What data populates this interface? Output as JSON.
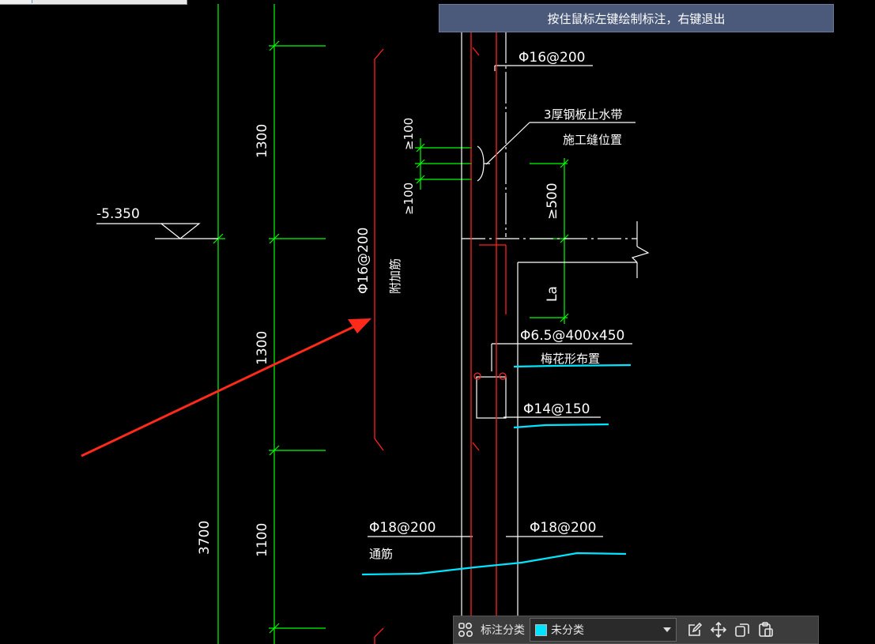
{
  "hint": {
    "text": "按住鼠标左键绘制标注，右键退出"
  },
  "toolbar": {
    "category_label": "标注分类",
    "category_selected": "未分类",
    "category_swatch_color": "#00e5ff",
    "icons": [
      "grid-apps-icon",
      "edit-icon",
      "move-icon",
      "copy-icon",
      "paste-icon"
    ]
  },
  "drawing": {
    "colors": {
      "dim_green": "#00ff00",
      "rebar_red": "#ff2020",
      "annotation_cyan": "#00e5ff",
      "text_white": "#ffffff",
      "arrow_red": "#ff2a1a"
    },
    "dims": {
      "d1300_top": "1300",
      "d1300_mid": "1300",
      "d1100": "1100",
      "d3700": "3700",
      "d100_a": "≥100",
      "d100_b": "≥100",
      "d500": "≥500",
      "la": "La"
    },
    "elevation": "-5.350",
    "labels": {
      "phi16_200_top": "Φ16@200",
      "waterstop": "3厚钢板止水带",
      "joint": "施工缝位置",
      "phi16_200_vert": "Φ16@200",
      "added_rebar": "附加筋",
      "phi6_5": "Φ6.5@400x450",
      "plum_layout": "梅花形布置",
      "phi14_150": "Φ14@150",
      "phi18_200_left": "Φ18@200",
      "through_rebar": "通筋",
      "phi18_200_right": "Φ18@200"
    }
  }
}
